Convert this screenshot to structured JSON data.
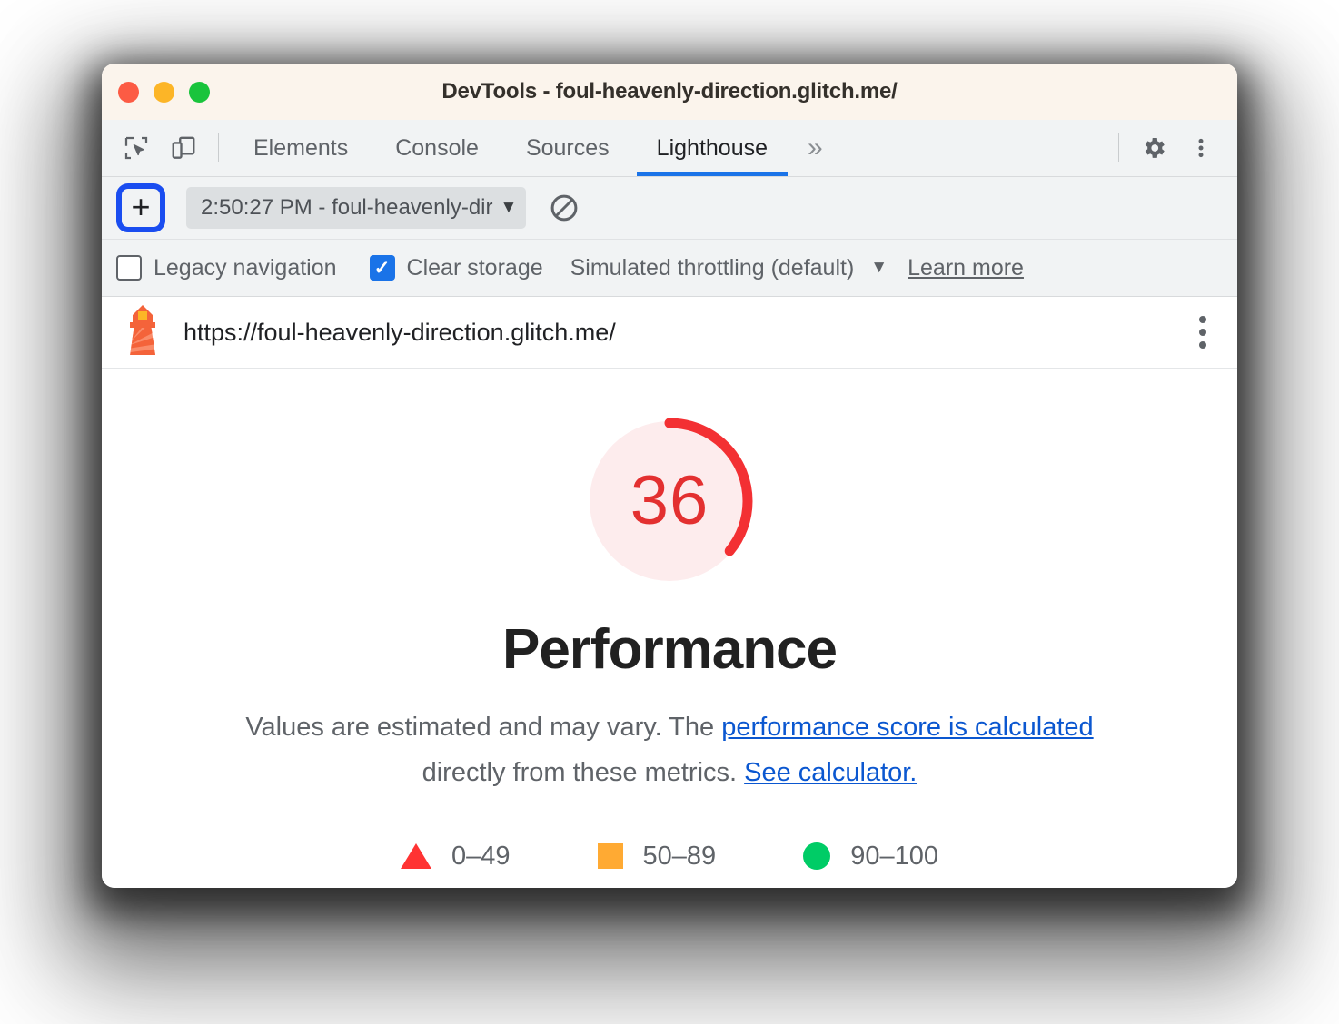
{
  "window": {
    "title": "DevTools - foul-heavenly-direction.glitch.me/",
    "traffic_lights": [
      "close",
      "minimize",
      "maximize"
    ]
  },
  "tab_strip": {
    "inspect_icon": "inspect-element-icon",
    "device_toggle_icon": "device-toolbar-icon",
    "tabs": [
      {
        "label": "Elements",
        "active": false
      },
      {
        "label": "Console",
        "active": false
      },
      {
        "label": "Sources",
        "active": false
      },
      {
        "label": "Lighthouse",
        "active": true
      }
    ],
    "more_tabs_glyph": "»",
    "settings_icon": "gear-icon",
    "main_menu_icon": "kebab-menu-icon",
    "active_tab_underline_color": "#1a73e8"
  },
  "lighthouse_toolbar": {
    "add_button_label": "+",
    "add_button_focus_ring_color": "#1a4df0",
    "report_select_value": "2:50:27 PM - foul-heavenly-dir",
    "report_select_caret": "▼",
    "clear_all_icon": "no-entry-icon"
  },
  "lighthouse_options": {
    "legacy_navigation": {
      "label": "Legacy navigation",
      "checked": false
    },
    "clear_storage": {
      "label": "Clear storage",
      "checked": true
    },
    "throttling": {
      "label": "Simulated throttling (default)",
      "caret": "▼"
    },
    "learn_more": "Learn more",
    "checked_color": "#1a73e8"
  },
  "report_header": {
    "lighthouse_icon": "lighthouse-icon",
    "url": "https://foul-heavenly-direction.glitch.me/",
    "kebab_icon": "kebab-menu-icon"
  },
  "report": {
    "category_title": "Performance",
    "description_prefix": "Values are estimated and may vary. The ",
    "description_link_1": "performance score is calculated",
    "description_middle": " directly from these metrics. ",
    "description_link_2": "See calculator.",
    "legend": [
      {
        "shape": "triangle",
        "range": "0–49",
        "color": "#ff3333"
      },
      {
        "shape": "square",
        "range": "50–89",
        "color": "#ffaa33"
      },
      {
        "shape": "circle",
        "range": "90–100",
        "color": "#00cc66"
      }
    ]
  },
  "chart_data": {
    "type": "pie",
    "title": "Performance",
    "score": 36,
    "max": 100,
    "unit": "%",
    "arc_color": "#f33033",
    "track_color": "#fdeced",
    "score_text_color": "#e33030",
    "categories": [
      "score",
      "remainder"
    ],
    "values": [
      36,
      64
    ],
    "legend_position": "bottom",
    "annotations": [
      "0–49",
      "50–89",
      "90–100"
    ]
  }
}
